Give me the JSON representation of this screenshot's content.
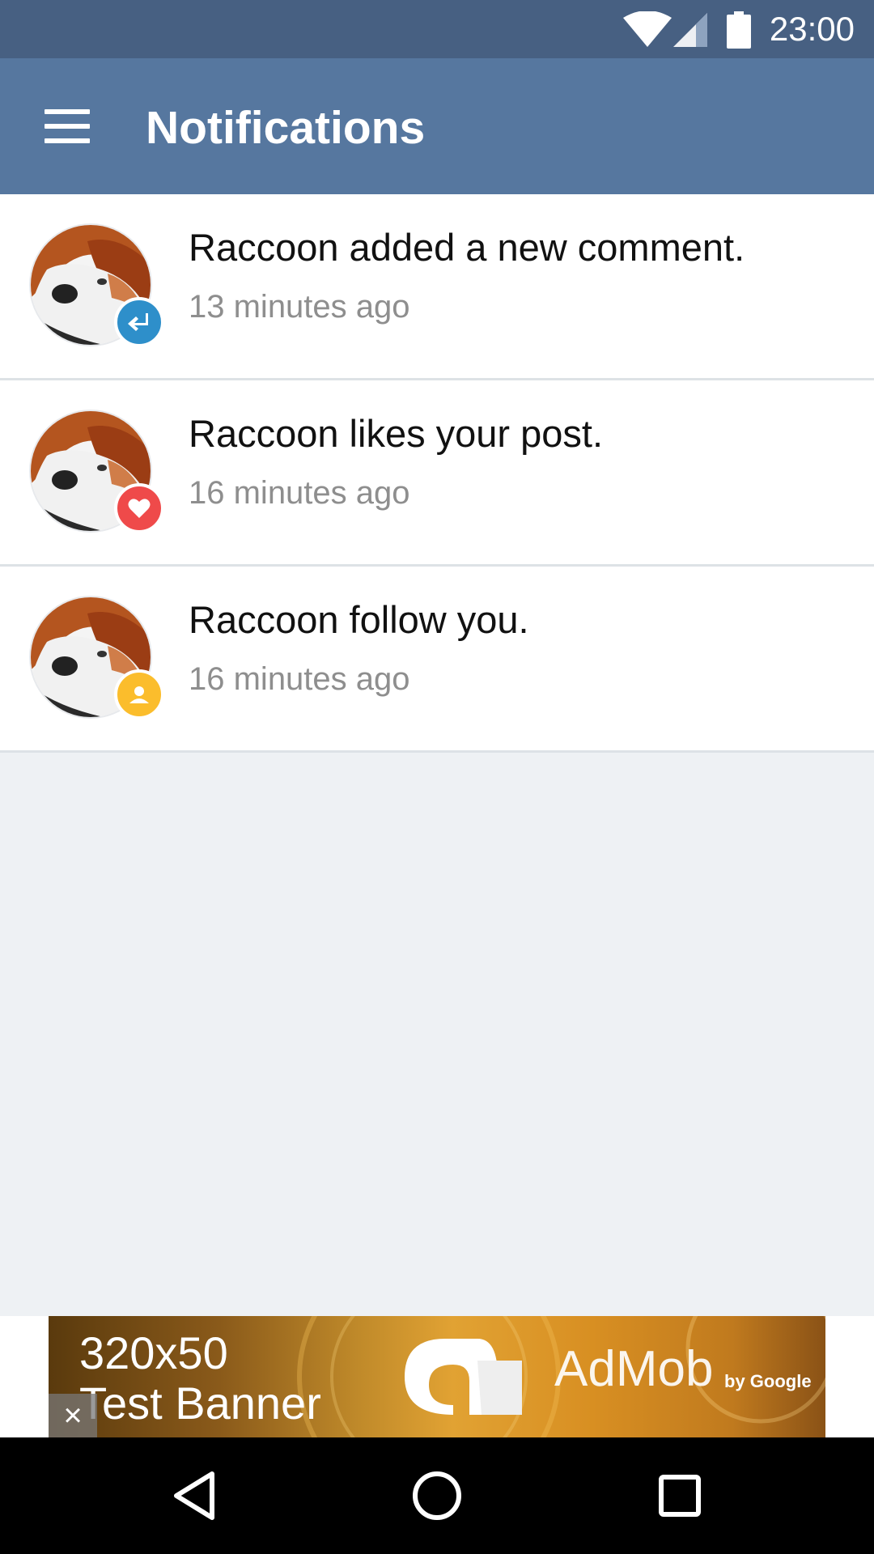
{
  "status_bar": {
    "time": "23:00",
    "icons": [
      "wifi-icon",
      "cell-signal-icon",
      "battery-icon"
    ],
    "background": "#476082"
  },
  "app_bar": {
    "title": "Notifications",
    "menu_icon": "hamburger-menu-icon",
    "background": "#56779f"
  },
  "notifications": [
    {
      "text": "Raccoon added a new comment.",
      "time": "13 minutes ago",
      "badge_icon": "reply-icon",
      "badge_color": "#2e8fca"
    },
    {
      "text": "Raccoon likes your post.",
      "time": "16 minutes ago",
      "badge_icon": "heart-icon",
      "badge_color": "#ef4a4a"
    },
    {
      "text": "Raccoon follow you.",
      "time": "16 minutes ago",
      "badge_icon": "person-icon",
      "badge_color": "#fbbd2c"
    }
  ],
  "ad_banner": {
    "line1": "320x50",
    "line2": "Test Banner",
    "brand": "AdMob",
    "brand_sub": "by Google",
    "close_label": "×"
  },
  "nav_bar": {
    "icons": [
      "back-icon",
      "home-icon",
      "recents-icon"
    ]
  }
}
